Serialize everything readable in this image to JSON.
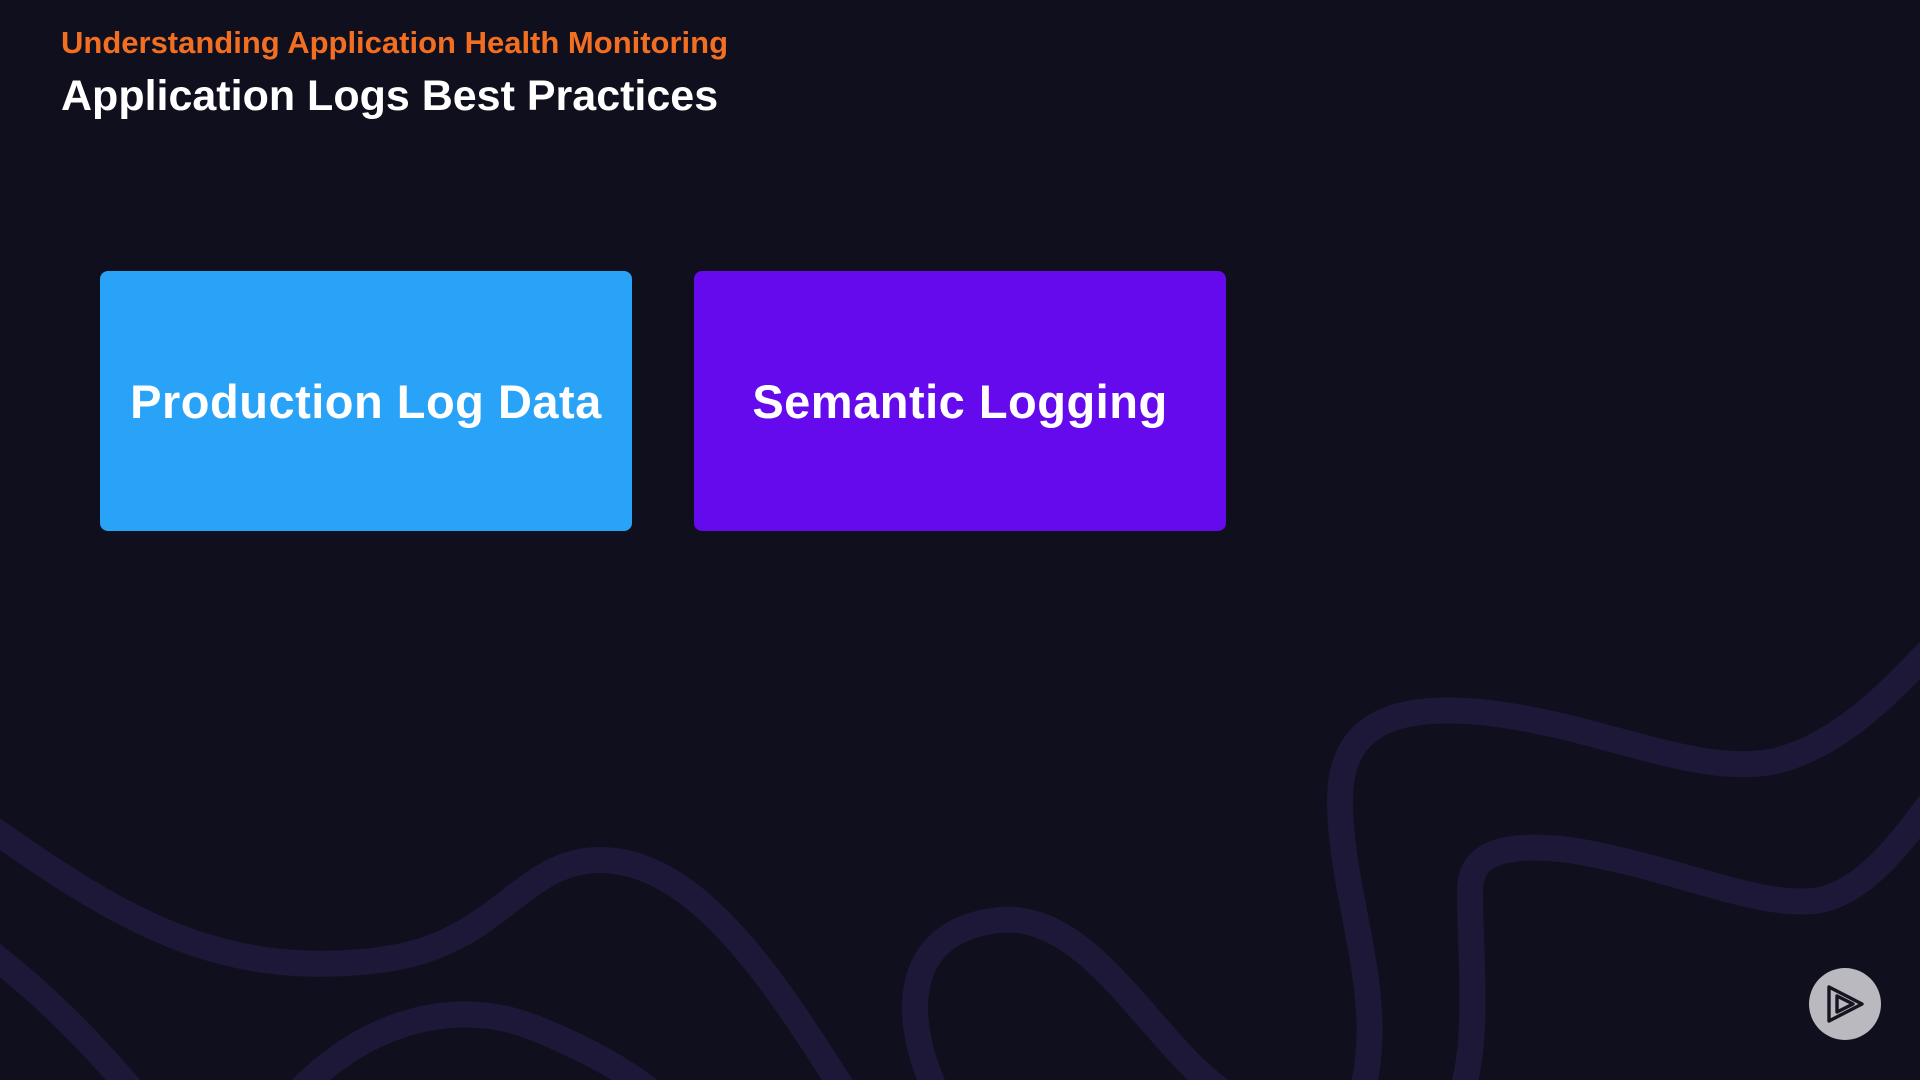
{
  "slide": {
    "section_title": "Understanding Application Health Monitoring",
    "title": "Application Logs Best Practices"
  },
  "cards": [
    {
      "label": "Production Log Data",
      "color": "#29a3f7"
    },
    {
      "label": "Semantic Logging",
      "color": "#660aee"
    }
  ],
  "colors": {
    "background": "#100f1e",
    "accent": "#f26f21",
    "wave": "#1d1838"
  },
  "controls": {
    "play_icon": "play-logo-icon"
  }
}
